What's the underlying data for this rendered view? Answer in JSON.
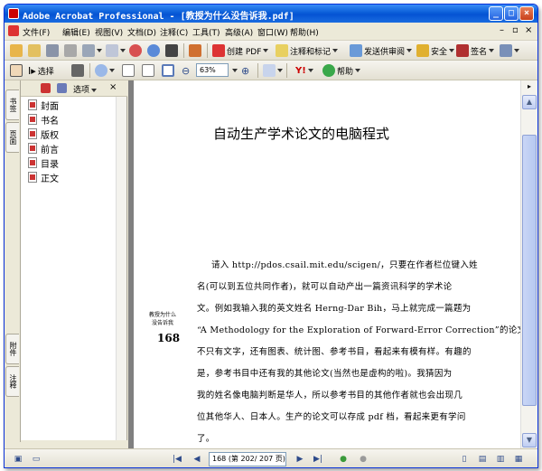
{
  "window": {
    "title": "Adobe Acrobat Professional - [教授为什么没告诉我.pdf]"
  },
  "menu": [
    "文件(F)",
    "编辑(E)",
    "视图(V)",
    "文档(D)",
    "注释(C)",
    "工具(T)",
    "高级(A)",
    "窗口(W)",
    "帮助(H)"
  ],
  "toolbar1": {
    "create_pdf": "创建 PDF",
    "review": "注释和标记",
    "send_review": "发送供审阅",
    "secure": "安全",
    "sign": "签名"
  },
  "toolbar2": {
    "select": "选择",
    "zoom": "63%",
    "help": "帮助"
  },
  "sidetabs": {
    "bookmarks": "书签",
    "pages": "页面",
    "attachments": "附件",
    "comments": "注释"
  },
  "bookmarks": {
    "options": "选项",
    "close": "×",
    "items": [
      "封面",
      "书名",
      "版权",
      "前言",
      "目录",
      "正文"
    ]
  },
  "page": {
    "title": "自动生产学术论文的电脑程式",
    "margin_note_1": "教授为什么",
    "margin_note_2": "没告诉我",
    "page_number": "168",
    "lines": [
      "请入 http://pdos.csail.mit.edu/scigen/，只要在作者栏位键入姓",
      "名(可以到五位共同作者)，就可以自动产出一篇资讯科学的学术论",
      "文。例如我输入我的英文姓名 Herng-Dar Bih，马上就完成一篇题为",
      "“A Methodology for the Exploration of Forward-Error Correction”的论文，",
      "不只有文字，还有图表、统计图、参考书目，看起来有模有样。有趣的",
      "是，参考书目中还有我的其他论文(当然也是虚构的啦)。我猜因为",
      "我的姓名像电脑判断是华人，所以参考书目的其他作者就也会出现几",
      "位其他华人、日本人。生产的论文可以存成 pdf 档，看起来更有学问",
      "了。"
    ]
  },
  "status": {
    "page_field": "168 (第 202/ 207 页)"
  }
}
